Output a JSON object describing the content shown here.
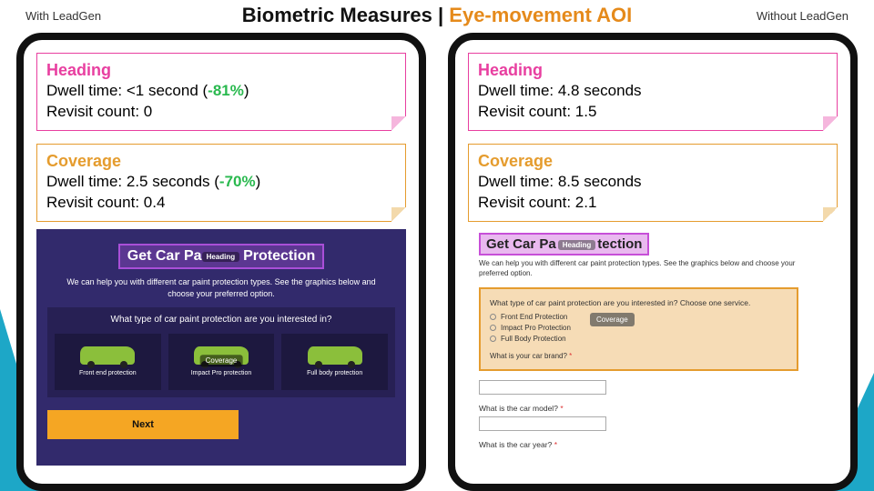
{
  "header": {
    "main": "Biometric Measures",
    "sep": " | ",
    "accent": "Eye-movement AOI"
  },
  "labels": {
    "left": "With LeadGen",
    "right": "Without LeadGen"
  },
  "left": {
    "heading_note": {
      "title": "Heading",
      "dwell_label": "Dwell time: ",
      "dwell_value": "<1 second (",
      "dwell_delta": "-81%",
      "dwell_close": ")",
      "revisit": "Revisit count: 0"
    },
    "coverage_note": {
      "title": "Coverage",
      "dwell_label": "Dwell time: ",
      "dwell_value": "2.5 seconds (",
      "dwell_delta": "-70%",
      "dwell_close": ")",
      "revisit": "Revisit count: 0.4"
    },
    "form": {
      "badge": "Heading",
      "title_pre": "Get Car Pa",
      "title_post": "Protection",
      "subtitle": "We can help you with different car paint protection types. See the graphics below and choose your preferred option.",
      "question": "What type of car paint protection are you interested in?",
      "options": [
        "Front end protection",
        "Impact Pro protection",
        "Full body protection"
      ],
      "cov_badge": "Coverage",
      "next": "Next"
    }
  },
  "right": {
    "heading_note": {
      "title": "Heading",
      "dwell": "Dwell time: 4.8 seconds",
      "revisit": "Revisit count: 1.5"
    },
    "coverage_note": {
      "title": "Coverage",
      "dwell": "Dwell time: 8.5 seconds",
      "revisit": "Revisit count: 2.1"
    },
    "form": {
      "title_pre": "Get Car Pa",
      "badge": "Heading",
      "title_post": "tection",
      "subtitle": "We can help you with different car paint protection types. See the graphics below and choose your preferred option.",
      "question": "What type of car paint protection are you interested in? Choose one service.",
      "options": [
        "Front End Protection",
        "Impact Pro Protection",
        "Full Body Protection"
      ],
      "cov_badge": "Coverage",
      "extra_q": "What is your car brand?",
      "q_model": "What is the car model?",
      "q_year": "What is the car year?",
      "req": "*"
    }
  }
}
